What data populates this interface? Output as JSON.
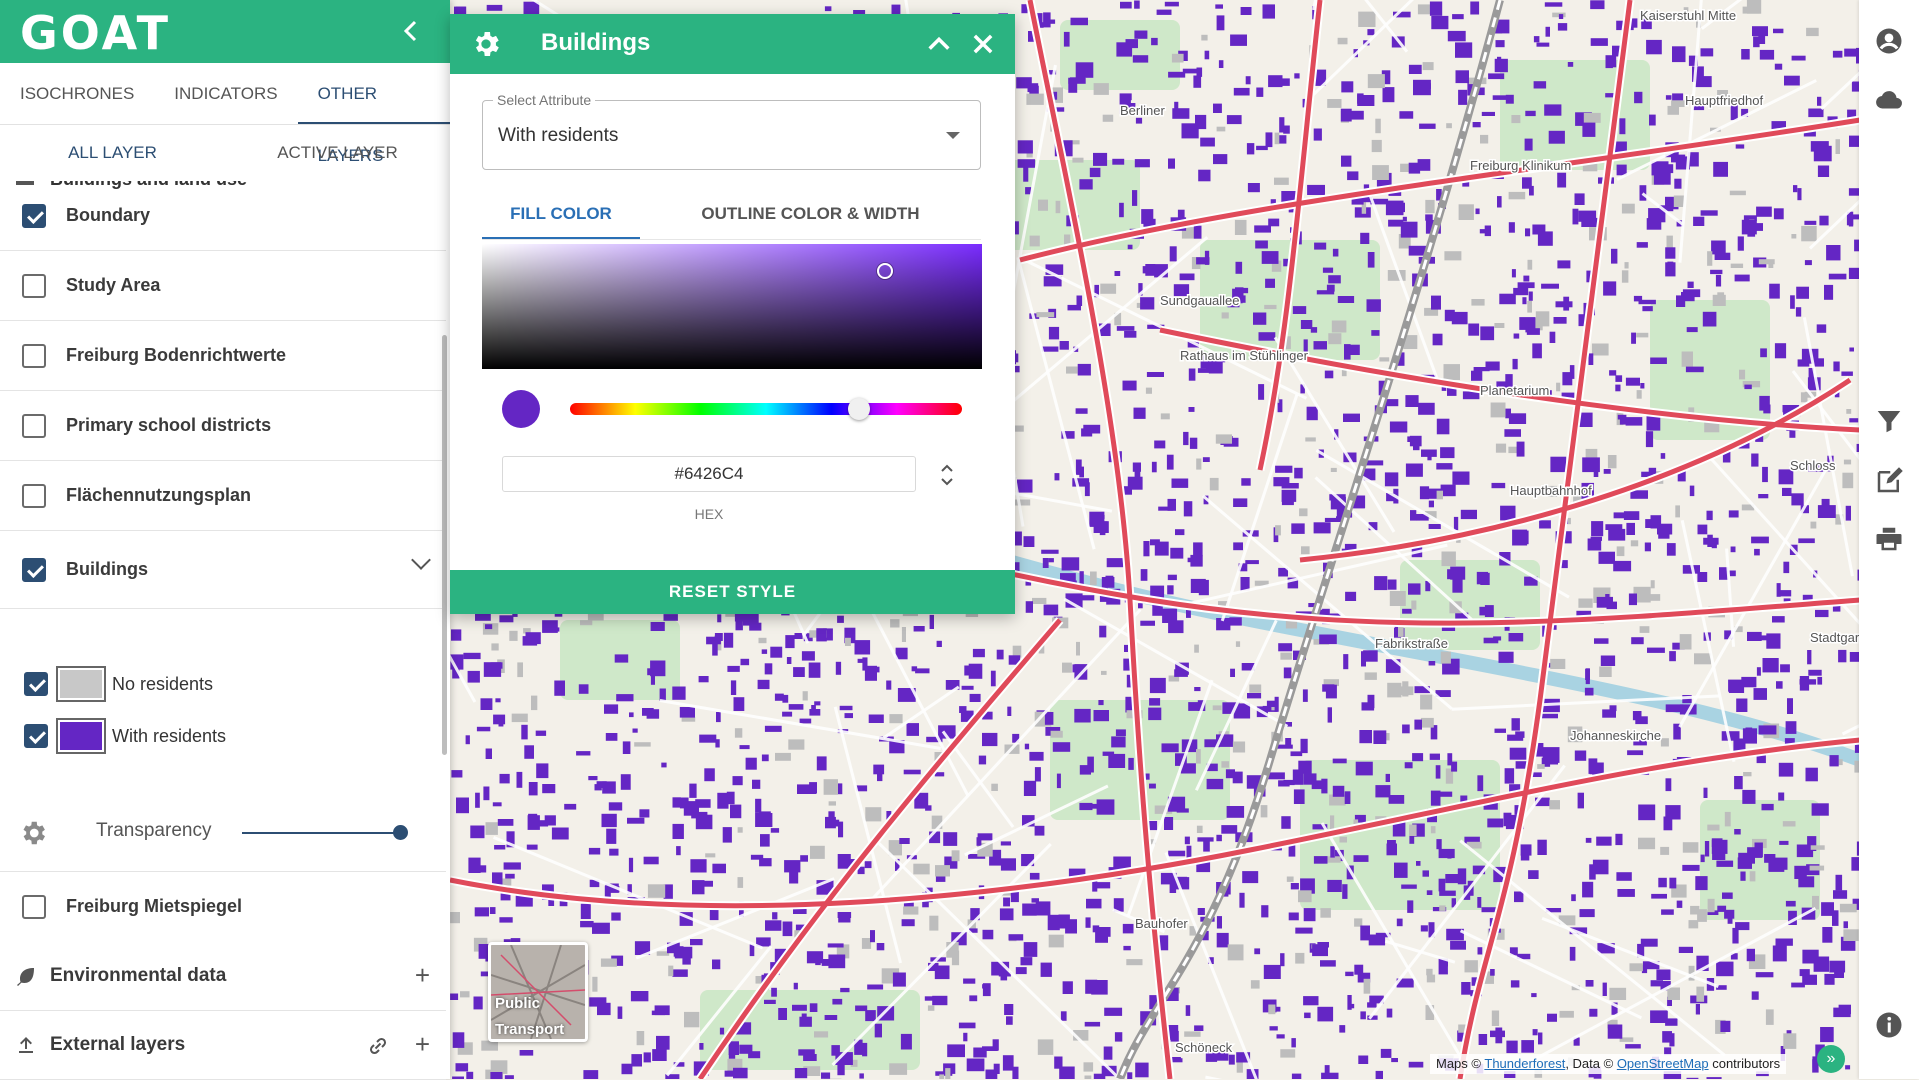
{
  "app": {
    "logo": "GOAT"
  },
  "main_tabs": [
    {
      "label": "ISOCHRONES",
      "active": false
    },
    {
      "label": "INDICATORS",
      "active": false
    },
    {
      "label": "OTHER LAYERS",
      "active": true
    }
  ],
  "sub_tabs": [
    {
      "label": "ALL LAYER",
      "active": true
    },
    {
      "label": "ACTIVE LAYER",
      "active": false
    }
  ],
  "layers": {
    "group_top_label": "Buildings and land use",
    "items": [
      {
        "label": "Boundary",
        "checked": true
      },
      {
        "label": "Study Area",
        "checked": false
      },
      {
        "label": "Freiburg Bodenrichtwerte",
        "checked": false
      },
      {
        "label": "Primary school districts",
        "checked": false
      },
      {
        "label": "Flächennutzungsplan",
        "checked": false
      },
      {
        "label": "Buildings",
        "checked": true
      }
    ],
    "legend": [
      {
        "label": "No residents",
        "checked": true,
        "color": "#c8c8c8"
      },
      {
        "label": "With residents",
        "checked": true,
        "color": "#6426C4"
      }
    ],
    "transparency_label": "Transparency",
    "transparency_value": 1.0,
    "after": {
      "label": "Freiburg Mietspiegel",
      "checked": false
    }
  },
  "groups": [
    {
      "label": "Environmental data",
      "icon": "leaf-icon"
    },
    {
      "label": "External layers",
      "icon": "upload-icon"
    }
  ],
  "style_dialog": {
    "title": "Buildings",
    "select_label": "Select Attribute",
    "select_value": "With residents",
    "tabs": [
      {
        "label": "FILL COLOR",
        "active": true
      },
      {
        "label": "OUTLINE COLOR & WIDTH",
        "active": false
      }
    ],
    "hex_value": "#6426C4",
    "hex_label": "HEX",
    "hue_value": 0.74,
    "reset_label": "RESET STYLE"
  },
  "map": {
    "basemap_label": "Public Transport",
    "attribution": {
      "prefix": "Maps ©",
      "link1": "Thunderforest",
      "middle": ", Data ©",
      "link2": "OpenStreetMap",
      "suffix": "contributors"
    },
    "place_labels": [
      "Kaiserstuhl Mitte",
      "Berliner",
      "Hauptfriedhof",
      "Freiburg Klinikum",
      "Rathaus im Stühlinger",
      "Hauptbahnhof",
      "Johanneskirche",
      "Sundgauallee",
      "Planetarium",
      "Schloss",
      "Fabrikstraße",
      "Stadtgarten",
      "Bauhofer",
      "Schöneck"
    ]
  },
  "colors": {
    "brand_green": "#2bb381",
    "navy": "#2c4e73",
    "building_fill": "#6426C4",
    "road": "#e04a5a"
  }
}
